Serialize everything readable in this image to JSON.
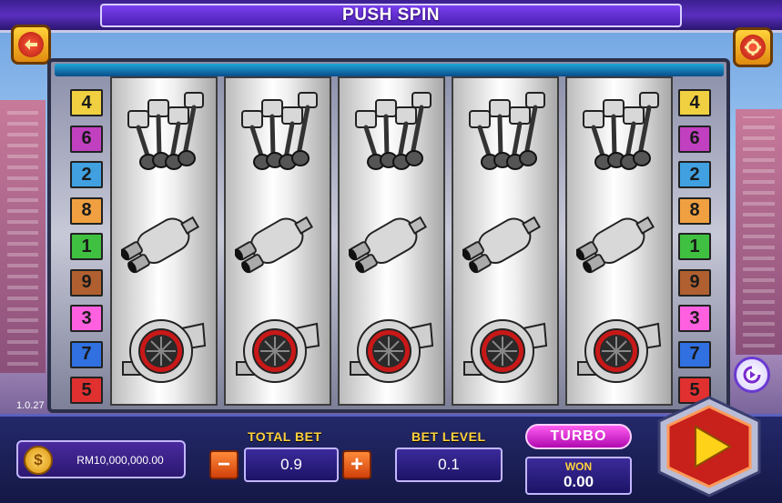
{
  "title": "PUSH SPIN",
  "version": "1.0.27",
  "buttons": {
    "back_icon": "back-arrow-icon",
    "settings_icon": "gear-icon",
    "autoplay_icon": "autoplay-icon",
    "spin_icon": "play-triangle-icon"
  },
  "paylines_left": [
    "4",
    "6",
    "2",
    "8",
    "1",
    "9",
    "3",
    "7",
    "5"
  ],
  "paylines_right": [
    "4",
    "6",
    "2",
    "8",
    "1",
    "9",
    "3",
    "7",
    "5"
  ],
  "payline_colors": [
    "#f0d040",
    "#c040c0",
    "#40a0e0",
    "#f0a040",
    "#40c040",
    "#b06030",
    "#ff60e0",
    "#3070e0",
    "#e03030"
  ],
  "reels": [
    {
      "symbols": [
        "pistons",
        "muffler",
        "turbo"
      ]
    },
    {
      "symbols": [
        "pistons",
        "muffler",
        "turbo"
      ]
    },
    {
      "symbols": [
        "pistons",
        "muffler",
        "turbo"
      ]
    },
    {
      "symbols": [
        "pistons",
        "muffler",
        "turbo"
      ]
    },
    {
      "symbols": [
        "pistons",
        "muffler",
        "turbo"
      ]
    }
  ],
  "balance": {
    "coin_symbol": "$",
    "amount": "RM10,000,000.00"
  },
  "total_bet": {
    "label": "TOTAL BET",
    "value": "0.9",
    "minus": "−",
    "plus": "+"
  },
  "bet_level": {
    "label": "BET LEVEL",
    "value": "0.1"
  },
  "turbo": {
    "label": "TURBO"
  },
  "won": {
    "label": "WON",
    "value": "0.00"
  }
}
